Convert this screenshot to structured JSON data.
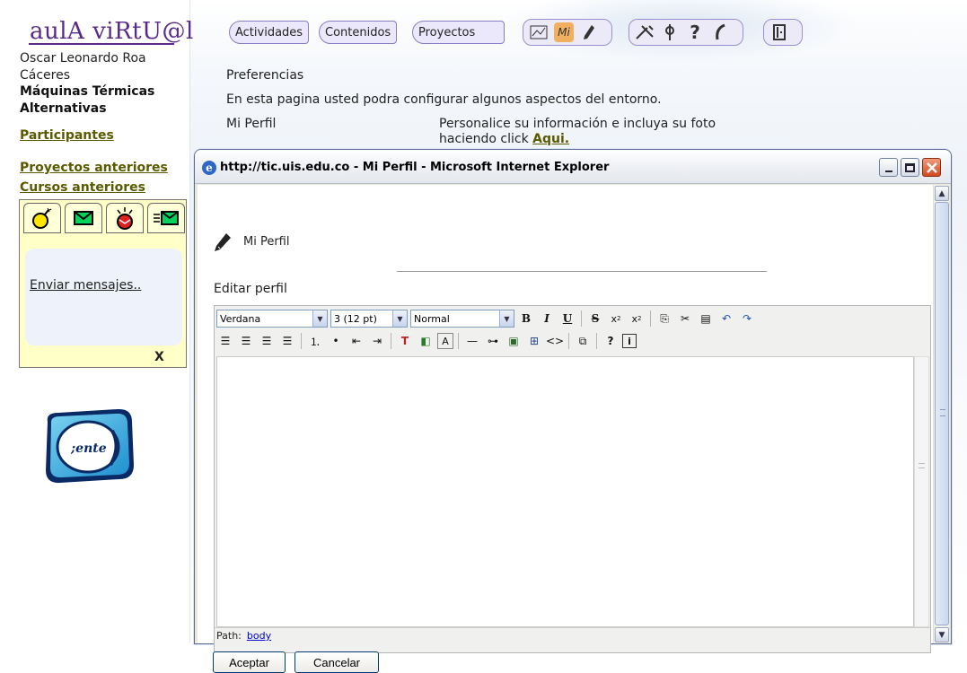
{
  "site": {
    "logo_text": "aulA viRtU@l",
    "user_name": "Oscar Leonardo Roa Cáceres",
    "course_name": "Máquinas Térmicas Alternativas",
    "links": [
      "Participantes",
      "Proyectos anteriores",
      "Cursos anteriores"
    ]
  },
  "messages_widget": {
    "tab_icons": [
      "bomb-icon",
      "envelope-icon",
      "alarm-envelope-icon",
      "envelope-lines-icon"
    ],
    "link": "Enviar mensajes..",
    "close": "X"
  },
  "nav": {
    "tabs": [
      "Actividades",
      "Contenidos",
      "Proyectos"
    ],
    "tool_icons": [
      "chart-icon",
      "mi-icon",
      "pencil-icon",
      "tools-icon",
      "pin-icon",
      "help-icon",
      "phone-icon",
      "exit-door-icon"
    ],
    "mi_label": "Mi"
  },
  "preferences": {
    "title": "Preferencias",
    "description": "En esta pagina usted podra configurar algunos aspectos del entorno.",
    "profile_label": "Mi Perfil",
    "profile_note": "Personalice su información e incluya su foto haciendo click ",
    "profile_link": "Aqui."
  },
  "popup": {
    "title": "http://tic.uis.edu.co - Mi Perfil - Microsoft Internet Explorer",
    "heading": "Mi Perfil",
    "edit_label": "Editar perfil",
    "editor": {
      "font_family": "Verdana",
      "font_size": "3 (12 pt)",
      "block_format": "Normal",
      "path_label": "Path:",
      "path_value": "body"
    },
    "buttons": {
      "accept": "Aceptar",
      "cancel": "Cancelar"
    }
  }
}
